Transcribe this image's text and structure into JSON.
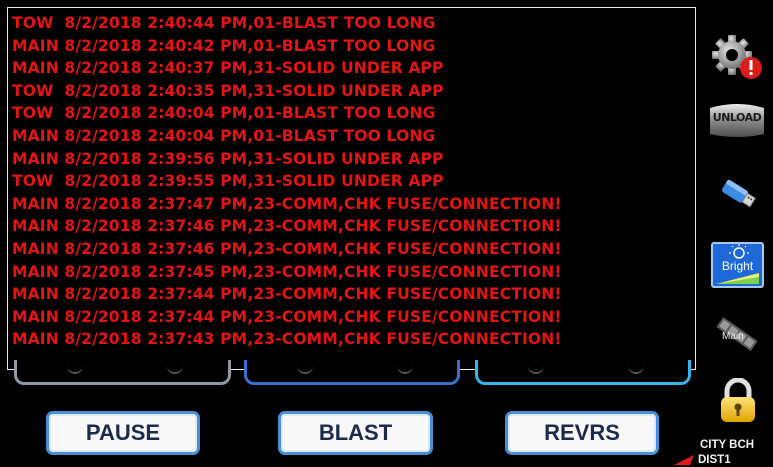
{
  "log": {
    "lines": [
      "TOW  8/2/2018 2:40:44 PM,01-BLAST TOO LONG",
      "MAIN 8/2/2018 2:40:42 PM,01-BLAST TOO LONG",
      "MAIN 8/2/2018 2:40:37 PM,31-SOLID UNDER APP",
      "TOW  8/2/2018 2:40:35 PM,31-SOLID UNDER APP",
      "TOW  8/2/2018 2:40:04 PM,01-BLAST TOO LONG",
      "MAIN 8/2/2018 2:40:04 PM,01-BLAST TOO LONG",
      "MAIN 8/2/2018 2:39:56 PM,31-SOLID UNDER APP",
      "TOW  8/2/2018 2:39:55 PM,31-SOLID UNDER APP",
      "MAIN 8/2/2018 2:37:47 PM,23-COMM,CHK FUSE/CONNECTION!",
      "MAIN 8/2/2018 2:37:46 PM,23-COMM,CHK FUSE/CONNECTION!",
      "MAIN 8/2/2018 2:37:46 PM,23-COMM,CHK FUSE/CONNECTION!",
      "MAIN 8/2/2018 2:37:45 PM,23-COMM,CHK FUSE/CONNECTION!",
      "MAIN 8/2/2018 2:37:44 PM,23-COMM,CHK FUSE/CONNECTION!",
      "MAIN 8/2/2018 2:37:44 PM,23-COMM,CHK FUSE/CONNECTION!",
      "MAIN 8/2/2018 2:37:43 PM,23-COMM,CHK FUSE/CONNECTION!"
    ],
    "text_color": "#e21414"
  },
  "buttons": {
    "pause": "PAUSE",
    "blast": "BLAST",
    "revrs": "REVRS"
  },
  "sidebar": {
    "settings_icon": "gear-alert-icon",
    "unload_label": "UNLOAD",
    "usb_icon": "usb-drive-icon",
    "bright_label": "Bright",
    "main_label": "Main",
    "lock_icon": "padlock-icon"
  },
  "status": {
    "location": "CITY BCH",
    "district": "DIST1"
  },
  "colors": {
    "accent_blue": "#4a8fd6",
    "arc_gray": "#8d9aa6",
    "arc_blue": "#3c6fd0",
    "arc_cyan": "#36b6e8"
  }
}
